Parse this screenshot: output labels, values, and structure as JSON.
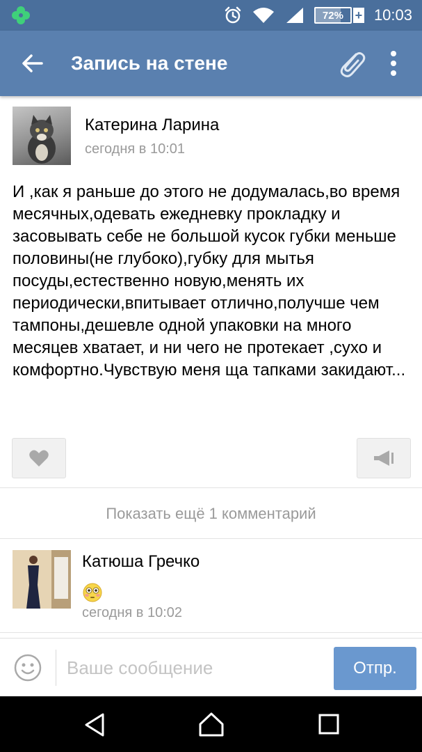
{
  "status_bar": {
    "icons": [
      "clover-icon",
      "alarm-icon",
      "wifi-icon",
      "signal-icon"
    ],
    "battery_level": 0.72,
    "battery_label": "72%",
    "battery_plus": "+",
    "time": "10:03"
  },
  "app_bar": {
    "title": "Запись на стене",
    "back_icon": "arrow-left-icon",
    "attach_icon": "paperclip-icon",
    "menu_icon": "more-vert-icon"
  },
  "post": {
    "author": "Катерина Ларина",
    "time": "сегодня в 10:01",
    "text": "И ,как я раньше до этого не додумалась,во время месячных,одевать ежедневку прокладку и засовывать себе не большой кусок губки меньше половины(не глубоко),губку для мытья посуды,естественно новую,менять их периодически,впитывает отлично,получше чем тампоны,дешевле одной упаковки на много месяцев хватает, и ни чего не протекает ,сухо и комфортно.Чувствую меня ща тапками закидают..."
  },
  "actions": {
    "like_icon": "heart-icon",
    "share_icon": "megaphone-icon"
  },
  "show_more": "Показать ещё 1 комментарий",
  "comment": {
    "author": "Катюша Гречко",
    "emoji": "flushed-face-emoji",
    "time": "сегодня в 10:02"
  },
  "input": {
    "placeholder": "Ваше сообщение",
    "value": "",
    "send_label": "Отпр.",
    "emoji_icon": "smiley-icon"
  },
  "nav_bar": {
    "icons": [
      "nav-back-icon",
      "nav-home-icon",
      "nav-recent-icon"
    ]
  },
  "colors": {
    "status_bar": "#4a6f9c",
    "app_bar": "#5a80af",
    "send_button": "#6a98cf",
    "secondary_text": "#9a9a9a"
  }
}
